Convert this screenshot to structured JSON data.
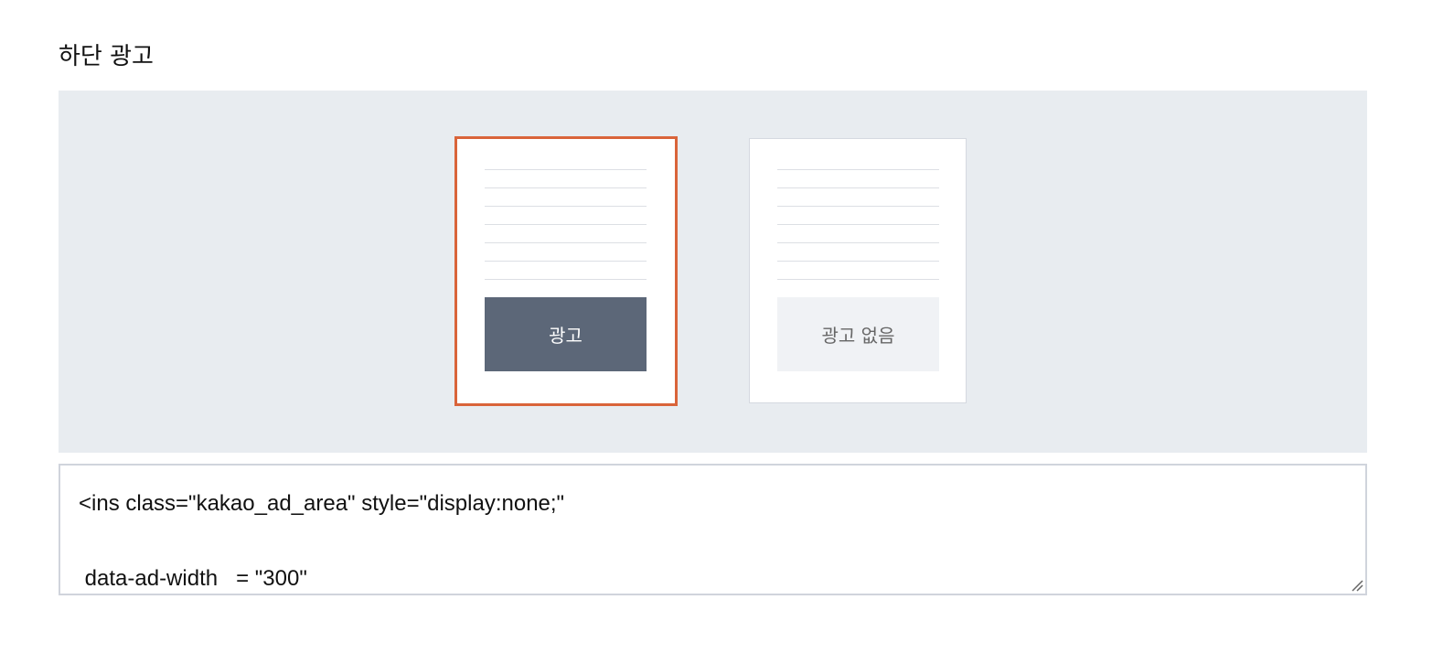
{
  "section": {
    "title": "하단 광고"
  },
  "options": [
    {
      "label": "광고",
      "selected": true
    },
    {
      "label": "광고 없음",
      "selected": false
    }
  ],
  "code": {
    "line1": "<ins class=\"kakao_ad_area\" style=\"display:none;\"",
    "line2": " data-ad-width   = \"300\""
  },
  "colors": {
    "selected_border": "#d9643a",
    "ad_block": "#5c6778",
    "panel_bg": "#e8ecf0"
  }
}
